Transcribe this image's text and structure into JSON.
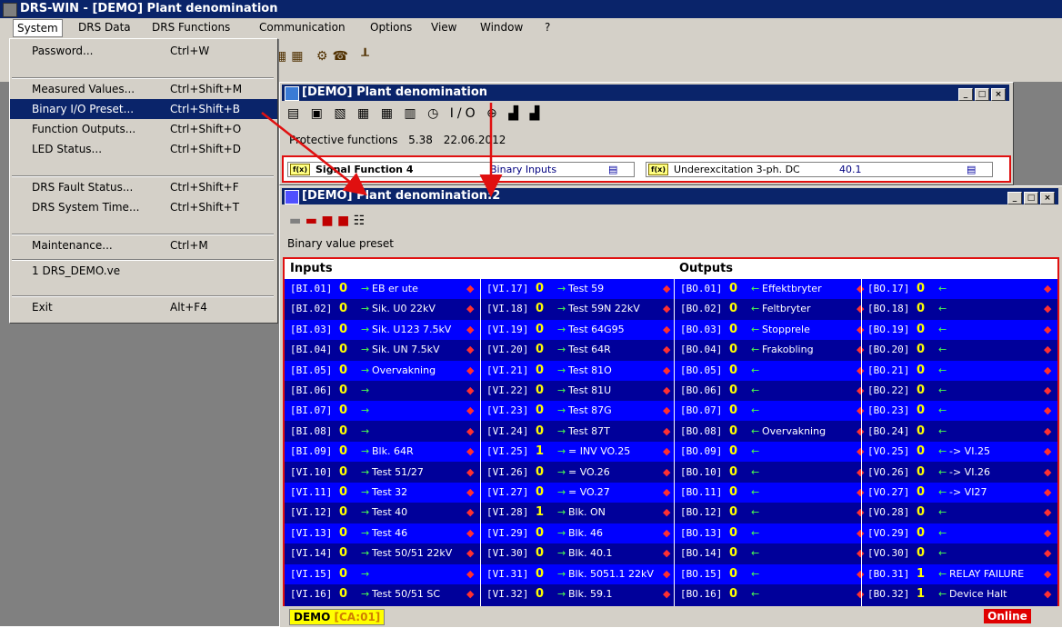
{
  "app": {
    "title": "DRS-WIN - [DEMO]  Plant denomination"
  },
  "menubar": {
    "items": [
      {
        "label": "System"
      },
      {
        "label": "DRS Data"
      },
      {
        "label": "DRS Functions"
      },
      {
        "label": "Communication"
      },
      {
        "label": "Options"
      },
      {
        "label": "View"
      },
      {
        "label": "Window"
      },
      {
        "label": "?"
      }
    ]
  },
  "system_menu": {
    "items": [
      {
        "label": "Password...",
        "shortcut": "Ctrl+W"
      },
      {
        "label": "Measured Values...",
        "shortcut": "Ctrl+Shift+M"
      },
      {
        "label": "Binary I/O Preset...",
        "shortcut": "Ctrl+Shift+B"
      },
      {
        "label": "Function Outputs...",
        "shortcut": "Ctrl+Shift+O"
      },
      {
        "label": "LED Status...",
        "shortcut": "Ctrl+Shift+D"
      },
      {
        "label": "DRS Fault Status...",
        "shortcut": "Ctrl+Shift+F"
      },
      {
        "label": "DRS System Time...",
        "shortcut": "Ctrl+Shift+T"
      },
      {
        "label": "Maintenance...",
        "shortcut": "Ctrl+M"
      },
      {
        "label": "1 DRS_DEMO.ve",
        "shortcut": ""
      },
      {
        "label": "Exit",
        "shortcut": "Alt+F4"
      }
    ]
  },
  "window1": {
    "title": "[DEMO]  Plant denomination",
    "info_label": "Protective functions",
    "version": "5.38",
    "date": "22.06.2012",
    "func1": {
      "code": "f(x)",
      "name": "Signal Function 4",
      "type": "Binary Inputs"
    },
    "func2": {
      "code": "f(x)",
      "name": "Underexcitation 3-ph. DC",
      "value": "40.1"
    }
  },
  "window2": {
    "title": "[DEMO]  Plant denomination:2",
    "subtitle": "Binary value preset",
    "inputs_header": "Inputs",
    "outputs_header": "Outputs",
    "status_demo": "DEMO",
    "status_ca": "[CA:01]",
    "status_online": "Online"
  },
  "binary": {
    "rows": [
      [
        [
          "[BI.01]",
          "0",
          "EB er ute"
        ],
        [
          "[VI.17]",
          "0",
          "Test 59"
        ],
        [
          "[BO.01]",
          "0",
          "Effektbryter"
        ],
        [
          "[BO.17]",
          "0",
          ""
        ]
      ],
      [
        [
          "[BI.02]",
          "0",
          "Sik. U0 22kV"
        ],
        [
          "[VI.18]",
          "0",
          "Test 59N 22kV"
        ],
        [
          "[BO.02]",
          "0",
          "Feltbryter"
        ],
        [
          "[BO.18]",
          "0",
          ""
        ]
      ],
      [
        [
          "[BI.03]",
          "0",
          "Sik. U123 7.5kV"
        ],
        [
          "[VI.19]",
          "0",
          "Test 64G95"
        ],
        [
          "[BO.03]",
          "0",
          "Stopprele"
        ],
        [
          "[BO.19]",
          "0",
          ""
        ]
      ],
      [
        [
          "[BI.04]",
          "0",
          "Sik. UN 7.5kV"
        ],
        [
          "[VI.20]",
          "0",
          "Test 64R"
        ],
        [
          "[BO.04]",
          "0",
          "Frakobling"
        ],
        [
          "[BO.20]",
          "0",
          ""
        ]
      ],
      [
        [
          "[BI.05]",
          "0",
          "Overvakning"
        ],
        [
          "[VI.21]",
          "0",
          "Test 81O"
        ],
        [
          "[BO.05]",
          "0",
          ""
        ],
        [
          "[BO.21]",
          "0",
          ""
        ]
      ],
      [
        [
          "[BI.06]",
          "0",
          ""
        ],
        [
          "[VI.22]",
          "0",
          "Test 81U"
        ],
        [
          "[BO.06]",
          "0",
          ""
        ],
        [
          "[BO.22]",
          "0",
          ""
        ]
      ],
      [
        [
          "[BI.07]",
          "0",
          ""
        ],
        [
          "[VI.23]",
          "0",
          "Test 87G"
        ],
        [
          "[BO.07]",
          "0",
          ""
        ],
        [
          "[BO.23]",
          "0",
          ""
        ]
      ],
      [
        [
          "[BI.08]",
          "0",
          ""
        ],
        [
          "[VI.24]",
          "0",
          "Test 87T"
        ],
        [
          "[BO.08]",
          "0",
          "Overvakning"
        ],
        [
          "[BO.24]",
          "0",
          ""
        ]
      ],
      [
        [
          "[BI.09]",
          "0",
          "Blk. 64R"
        ],
        [
          "[VI.25]",
          "1",
          "= INV VO.25"
        ],
        [
          "[BO.09]",
          "0",
          ""
        ],
        [
          "[VO.25]",
          "0",
          "-> VI.25"
        ]
      ],
      [
        [
          "[VI.10]",
          "0",
          "Test 51/27"
        ],
        [
          "[VI.26]",
          "0",
          "= VO.26"
        ],
        [
          "[BO.10]",
          "0",
          ""
        ],
        [
          "[VO.26]",
          "0",
          "-> VI.26"
        ]
      ],
      [
        [
          "[VI.11]",
          "0",
          "Test 32"
        ],
        [
          "[VI.27]",
          "0",
          "= VO.27"
        ],
        [
          "[BO.11]",
          "0",
          ""
        ],
        [
          "[VO.27]",
          "0",
          "-> VI27"
        ]
      ],
      [
        [
          "[VI.12]",
          "0",
          "Test 40"
        ],
        [
          "[VI.28]",
          "1",
          "Blk. ON"
        ],
        [
          "[BO.12]",
          "0",
          ""
        ],
        [
          "[VO.28]",
          "0",
          ""
        ]
      ],
      [
        [
          "[VI.13]",
          "0",
          "Test 46"
        ],
        [
          "[VI.29]",
          "0",
          "Blk. 46"
        ],
        [
          "[BO.13]",
          "0",
          ""
        ],
        [
          "[VO.29]",
          "0",
          ""
        ]
      ],
      [
        [
          "[VI.14]",
          "0",
          "Test 50/51 22kV"
        ],
        [
          "[VI.30]",
          "0",
          "Blk. 40.1"
        ],
        [
          "[BO.14]",
          "0",
          ""
        ],
        [
          "[VO.30]",
          "0",
          ""
        ]
      ],
      [
        [
          "[VI.15]",
          "0",
          ""
        ],
        [
          "[VI.31]",
          "0",
          "Blk. 5051.1 22kV"
        ],
        [
          "[BO.15]",
          "0",
          ""
        ],
        [
          "[BO.31]",
          "1",
          "RELAY FAILURE"
        ]
      ],
      [
        [
          "[VI.16]",
          "0",
          "Test 50/51 SC"
        ],
        [
          "[VI.32]",
          "0",
          "Blk. 59.1"
        ],
        [
          "[BO.16]",
          "0",
          ""
        ],
        [
          "[BO.32]",
          "1",
          "Device Halt"
        ]
      ]
    ]
  },
  "colors": {
    "accent": "#0a246a",
    "grid_dark": "#00009a",
    "grid_light": "#0000ff",
    "highlight_frame": "#e01010"
  },
  "icons": {
    "arrow_in": "arrow-right-icon",
    "arrow_out": "arrow-left-icon",
    "red_marker": "red-diamond-icon"
  }
}
